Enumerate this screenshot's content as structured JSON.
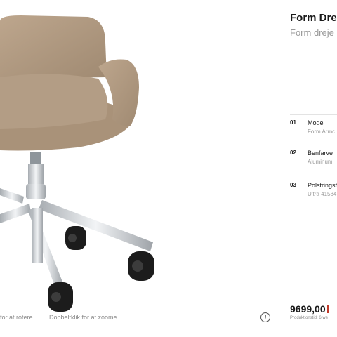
{
  "product": {
    "title": "Form Dre",
    "subtitle": "Form dreje"
  },
  "viewer": {
    "hint_rotate": "for at rotere",
    "hint_zoom": "Dobbeltklik for at zoome",
    "info_icon": "!"
  },
  "specs": [
    {
      "num": "01",
      "label": "Model",
      "value": "Form Armc"
    },
    {
      "num": "02",
      "label": "Benfarve",
      "value": "Aluminum"
    },
    {
      "num": "03",
      "label": "Polstringsf",
      "value": "Ultra 41584"
    }
  ],
  "price": {
    "amount": "9699,00",
    "delivery": "Produktionstid: 6 we"
  },
  "colors": {
    "upholstery": "#b29c84",
    "aluminium": "#d6d9dc",
    "caster": "#1c1c1c",
    "accent": "#c23a2a"
  }
}
